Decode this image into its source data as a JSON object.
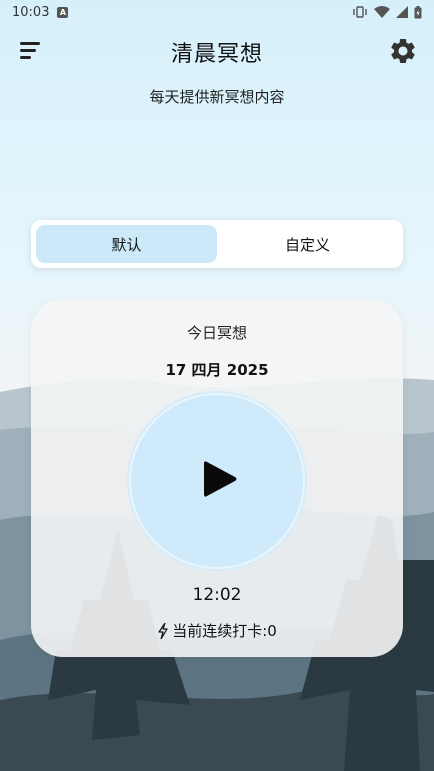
{
  "status_bar": {
    "time": "10:03",
    "notification_icon": "a-notification-icon",
    "icons": [
      "vibrate-icon",
      "wifi-icon",
      "signal-icon",
      "battery-icon"
    ]
  },
  "header": {
    "title": "清晨冥想",
    "menu_icon": "menu-icon",
    "settings_icon": "gear-icon"
  },
  "subtitle": "每天提供新冥想内容",
  "mode_tabs": [
    {
      "label": "默认",
      "active": true
    },
    {
      "label": "自定义",
      "active": false
    }
  ],
  "card": {
    "label": "今日冥想",
    "date": "17 四月 2025",
    "play_icon": "play-icon",
    "time": "12:02",
    "streak_icon": "bolt-icon",
    "streak_text": "当前连续打卡:0"
  },
  "colors": {
    "accent": "#cce9fa",
    "play_circle": "#cfeafb",
    "card_bg": "#f4f5f6",
    "sky_top": "#d9f2fb",
    "mountain": "#6a8494",
    "tree": "#2b3a42"
  }
}
